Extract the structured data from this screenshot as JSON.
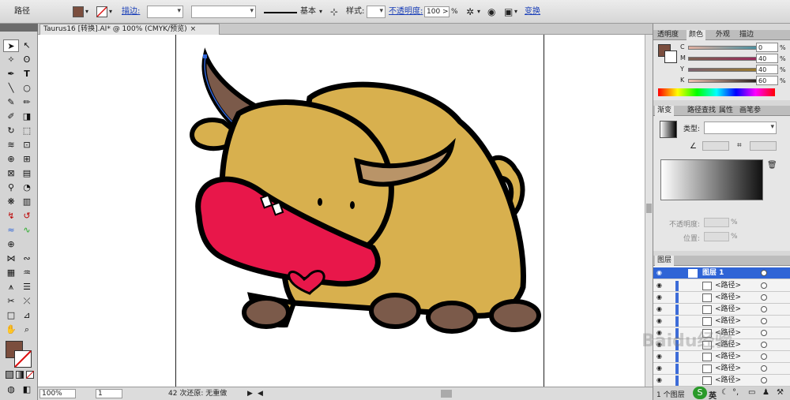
{
  "control_bar": {
    "object_type": "路径",
    "stroke_label": "描边:",
    "stroke_profile": "基本",
    "style_label": "样式:",
    "opacity_label": "不透明度:",
    "opacity_value": "100",
    "opacity_unit": ">",
    "pct": "%",
    "transform_link": "变换",
    "fill_color": "#7b4e3e"
  },
  "document": {
    "tab_title": "Taurus16 [转换].AI* @ 100% (CMYK/预览)"
  },
  "status_bar": {
    "zoom": "100%",
    "page": "1",
    "message": "42 次还原: 无重做"
  },
  "color_panel": {
    "tabs": [
      "透明度",
      "颜色",
      "外观",
      "描边"
    ],
    "active_tab": "颜色",
    "channels": [
      {
        "label": "C",
        "value": "0"
      },
      {
        "label": "M",
        "value": "40"
      },
      {
        "label": "Y",
        "value": "40"
      },
      {
        "label": "K",
        "value": "60"
      }
    ],
    "pct": "%"
  },
  "gradient_panel": {
    "tabs": [
      "渐变",
      "路径查找",
      "属性",
      "画笔参"
    ],
    "active_tab": "渐变",
    "type_label": "类型:",
    "opacity_label": "不透明度:",
    "location_label": "位置:",
    "pct": "%"
  },
  "layers_panel": {
    "title": "图层",
    "layer_name": "图层 1",
    "sublayers": [
      "<路径>",
      "<路径>",
      "<路径>",
      "<路径>",
      "<路径>",
      "<路径>",
      "<路径>",
      "<路径>",
      "<路径>"
    ],
    "footer": "1 个图层"
  },
  "taskbar": {
    "ime": "英"
  },
  "watermark": "Baidu经验",
  "colors": {
    "accent_blue": "#2f64d6",
    "ox_body": "#d8b04e",
    "ox_mouth": "#e8174a",
    "ox_brown": "#7b5a4a"
  }
}
